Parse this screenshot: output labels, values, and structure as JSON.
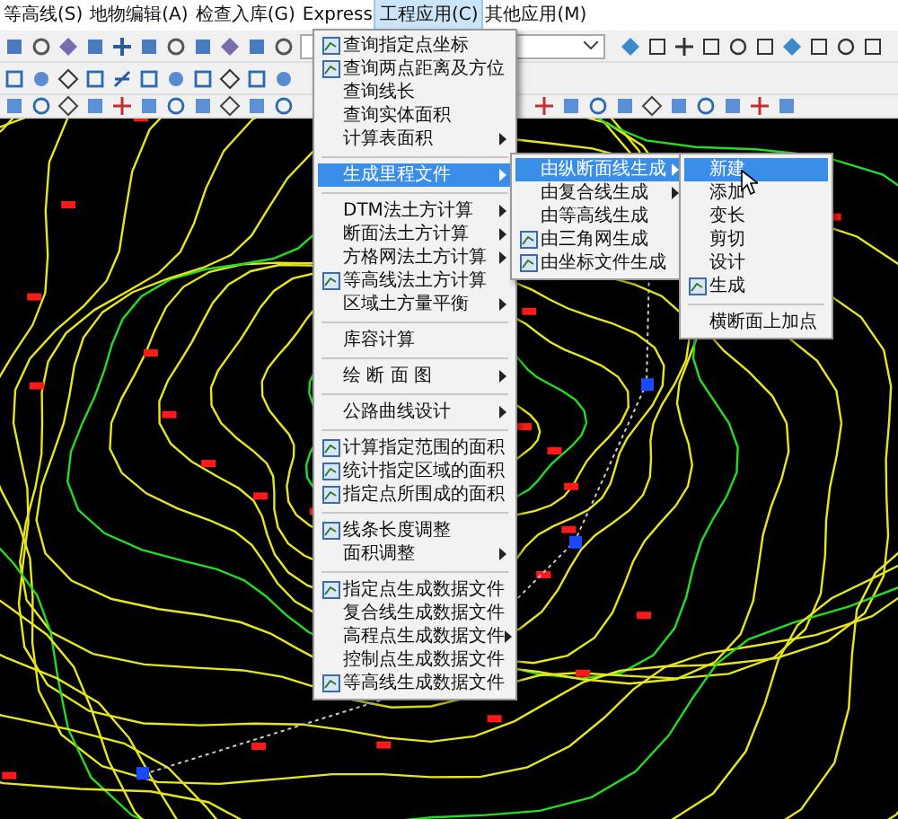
{
  "menu_bar": [
    {
      "label": "等高线(S)",
      "selected": false
    },
    {
      "label": "地物编辑(A)",
      "selected": false
    },
    {
      "label": "检查入库(G)",
      "selected": false
    },
    {
      "label": "Express",
      "selected": false
    },
    {
      "label": "工程应用(C)",
      "selected": true
    },
    {
      "label": "其他应用(M)",
      "selected": false
    }
  ],
  "menu": {
    "items": [
      {
        "kind": "item",
        "label": "查询指定点坐标",
        "has_icon": true,
        "submenu": false,
        "selected": false
      },
      {
        "kind": "item",
        "label": "查询两点距离及方位",
        "has_icon": true,
        "submenu": false,
        "selected": false
      },
      {
        "kind": "item",
        "label": "查询线长",
        "has_icon": false,
        "submenu": false,
        "selected": false
      },
      {
        "kind": "item",
        "label": "查询实体面积",
        "has_icon": false,
        "submenu": false,
        "selected": false
      },
      {
        "kind": "item",
        "label": "计算表面积",
        "has_icon": false,
        "submenu": true,
        "selected": false
      },
      {
        "kind": "separator"
      },
      {
        "kind": "item",
        "label": "生成里程文件",
        "has_icon": false,
        "submenu": true,
        "selected": true
      },
      {
        "kind": "separator"
      },
      {
        "kind": "item",
        "label": "DTM法土方计算",
        "has_icon": false,
        "submenu": true,
        "selected": false
      },
      {
        "kind": "item",
        "label": "断面法土方计算",
        "has_icon": false,
        "submenu": true,
        "selected": false
      },
      {
        "kind": "item",
        "label": "方格网法土方计算",
        "has_icon": false,
        "submenu": true,
        "selected": false
      },
      {
        "kind": "item",
        "label": "等高线法土方计算",
        "has_icon": true,
        "submenu": false,
        "selected": false
      },
      {
        "kind": "item",
        "label": "区域土方量平衡",
        "has_icon": false,
        "submenu": true,
        "selected": false
      },
      {
        "kind": "separator"
      },
      {
        "kind": "item",
        "label": "库容计算",
        "has_icon": false,
        "submenu": false,
        "selected": false
      },
      {
        "kind": "separator"
      },
      {
        "kind": "item",
        "label": "绘 断 面 图",
        "has_icon": false,
        "submenu": true,
        "selected": false
      },
      {
        "kind": "separator"
      },
      {
        "kind": "item",
        "label": "公路曲线设计",
        "has_icon": false,
        "submenu": true,
        "selected": false
      },
      {
        "kind": "separator"
      },
      {
        "kind": "item",
        "label": "计算指定范围的面积",
        "has_icon": true,
        "submenu": false,
        "selected": false
      },
      {
        "kind": "item",
        "label": "统计指定区域的面积",
        "has_icon": true,
        "submenu": false,
        "selected": false
      },
      {
        "kind": "item",
        "label": "指定点所围成的面积",
        "has_icon": true,
        "submenu": false,
        "selected": false
      },
      {
        "kind": "separator"
      },
      {
        "kind": "item",
        "label": "线条长度调整",
        "has_icon": true,
        "submenu": false,
        "selected": false
      },
      {
        "kind": "item",
        "label": "面积调整",
        "has_icon": false,
        "submenu": true,
        "selected": false
      },
      {
        "kind": "separator"
      },
      {
        "kind": "item",
        "label": "指定点生成数据文件",
        "has_icon": true,
        "submenu": false,
        "selected": false
      },
      {
        "kind": "item",
        "label": "复合线生成数据文件",
        "has_icon": false,
        "submenu": false,
        "selected": false
      },
      {
        "kind": "item",
        "label": "高程点生成数据文件",
        "has_icon": false,
        "submenu": true,
        "selected": false
      },
      {
        "kind": "item",
        "label": "控制点生成数据文件",
        "has_icon": false,
        "submenu": false,
        "selected": false
      },
      {
        "kind": "item",
        "label": "等高线生成数据文件",
        "has_icon": true,
        "submenu": false,
        "selected": false
      }
    ]
  },
  "submenu": {
    "items": [
      {
        "kind": "item",
        "label": "由纵断面线生成",
        "has_icon": false,
        "submenu": true,
        "selected": true
      },
      {
        "kind": "item",
        "label": "由复合线生成",
        "has_icon": false,
        "submenu": true,
        "selected": false
      },
      {
        "kind": "item",
        "label": "由等高线生成",
        "has_icon": false,
        "submenu": false,
        "selected": false
      },
      {
        "kind": "item",
        "label": "由三角网生成",
        "has_icon": true,
        "submenu": false,
        "selected": false
      },
      {
        "kind": "item",
        "label": "由坐标文件生成",
        "has_icon": true,
        "submenu": false,
        "selected": false
      }
    ]
  },
  "submenu_2": {
    "items": [
      {
        "kind": "item",
        "label": "新建",
        "has_icon": false,
        "submenu": false,
        "selected": true
      },
      {
        "kind": "item",
        "label": "添加",
        "has_icon": false,
        "submenu": false,
        "selected": false
      },
      {
        "kind": "item",
        "label": "变长",
        "has_icon": false,
        "submenu": false,
        "selected": false
      },
      {
        "kind": "item",
        "label": "剪切",
        "has_icon": false,
        "submenu": false,
        "selected": false
      },
      {
        "kind": "item",
        "label": "设计",
        "has_icon": false,
        "submenu": false,
        "selected": false
      },
      {
        "kind": "item",
        "label": "生成",
        "has_icon": true,
        "submenu": false,
        "selected": false
      },
      {
        "kind": "separator"
      },
      {
        "kind": "item",
        "label": "横断面上加点",
        "has_icon": false,
        "submenu": false,
        "selected": false
      }
    ]
  }
}
